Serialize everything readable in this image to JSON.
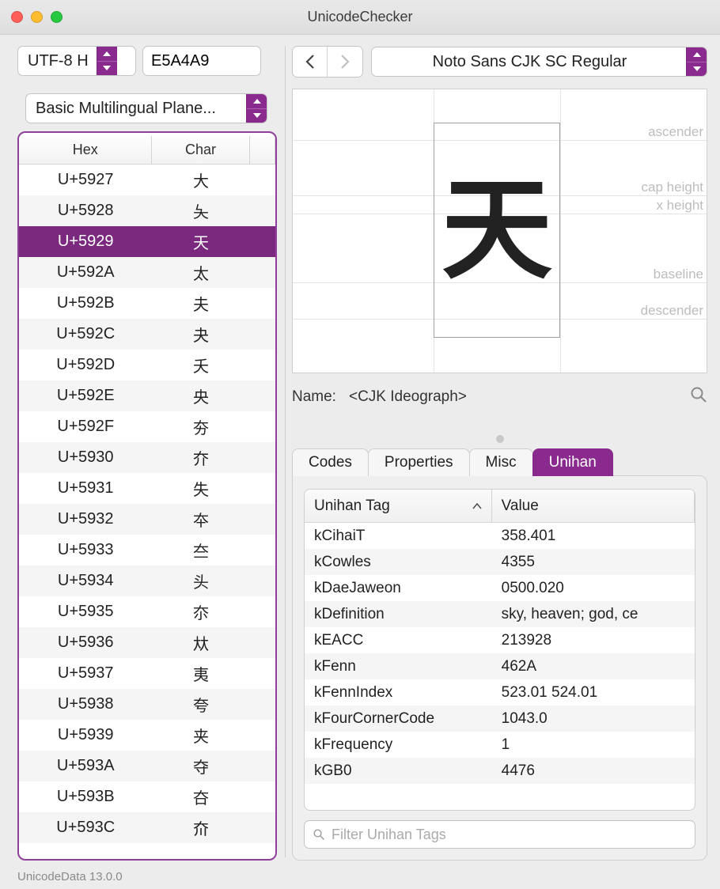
{
  "window": {
    "title": "UnicodeChecker"
  },
  "encoding": {
    "selected": "UTF-8 H",
    "hex_value": "E5A4A9"
  },
  "plane": {
    "selected": "Basic Multilingual Plane..."
  },
  "list": {
    "columns": {
      "hex": "Hex",
      "char": "Char"
    },
    "selected_index": 2,
    "rows": [
      {
        "hex": "U+5927",
        "char": "大"
      },
      {
        "hex": "U+5928",
        "char": "夨"
      },
      {
        "hex": "U+5929",
        "char": "天"
      },
      {
        "hex": "U+592A",
        "char": "太"
      },
      {
        "hex": "U+592B",
        "char": "夫"
      },
      {
        "hex": "U+592C",
        "char": "夬"
      },
      {
        "hex": "U+592D",
        "char": "夭"
      },
      {
        "hex": "U+592E",
        "char": "央"
      },
      {
        "hex": "U+592F",
        "char": "夯"
      },
      {
        "hex": "U+5930",
        "char": "夰"
      },
      {
        "hex": "U+5931",
        "char": "失"
      },
      {
        "hex": "U+5932",
        "char": "夲"
      },
      {
        "hex": "U+5933",
        "char": "夳"
      },
      {
        "hex": "U+5934",
        "char": "头"
      },
      {
        "hex": "U+5935",
        "char": "夵"
      },
      {
        "hex": "U+5936",
        "char": "夶"
      },
      {
        "hex": "U+5937",
        "char": "夷"
      },
      {
        "hex": "U+5938",
        "char": "夸"
      },
      {
        "hex": "U+5939",
        "char": "夹"
      },
      {
        "hex": "U+593A",
        "char": "夺"
      },
      {
        "hex": "U+593B",
        "char": "夻"
      },
      {
        "hex": "U+593C",
        "char": "夼"
      }
    ]
  },
  "font": {
    "selected": "Noto Sans CJK SC Regular"
  },
  "glyph": {
    "char": "天",
    "guides": {
      "ascender": "ascender",
      "cap_height": "cap height",
      "x_height": "x height",
      "baseline": "baseline",
      "descender": "descender"
    }
  },
  "name": {
    "label": "Name:",
    "value": "<CJK Ideograph>"
  },
  "tabs": {
    "items": [
      "Codes",
      "Properties",
      "Misc",
      "Unihan"
    ],
    "active_index": 3
  },
  "unihan": {
    "columns": {
      "tag": "Unihan Tag",
      "value": "Value"
    },
    "rows": [
      {
        "tag": "kCihaiT",
        "value": "358.401"
      },
      {
        "tag": "kCowles",
        "value": "4355"
      },
      {
        "tag": "kDaeJaweon",
        "value": "0500.020"
      },
      {
        "tag": "kDefinition",
        "value": "sky, heaven; god, ce"
      },
      {
        "tag": "kEACC",
        "value": "213928"
      },
      {
        "tag": "kFenn",
        "value": "462A"
      },
      {
        "tag": "kFennIndex",
        "value": "523.01 524.01"
      },
      {
        "tag": "kFourCornerCode",
        "value": "1043.0"
      },
      {
        "tag": "kFrequency",
        "value": "1"
      },
      {
        "tag": "kGB0",
        "value": "4476"
      }
    ],
    "filter_placeholder": "Filter Unihan Tags"
  },
  "footer": {
    "version": "UnicodeData 13.0.0"
  }
}
